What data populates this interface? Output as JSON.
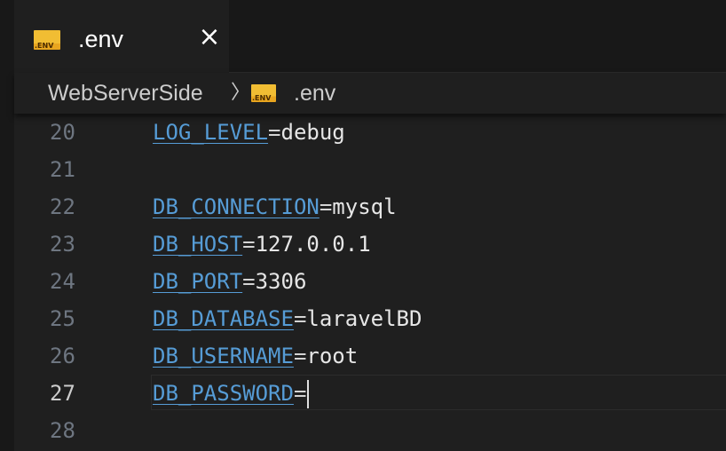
{
  "tab": {
    "icon_text": ".ENV",
    "label": ".env",
    "close_glyph": "×"
  },
  "breadcrumb": {
    "folder": "WebServerSide",
    "separator": "〉",
    "icon_text": ".ENV",
    "file": ".env"
  },
  "editor": {
    "active_line": 27,
    "lines": [
      {
        "num": "20",
        "key": "LOG_LEVEL",
        "eq": "=",
        "value": "debug"
      },
      {
        "num": "21",
        "key": "",
        "eq": "",
        "value": ""
      },
      {
        "num": "22",
        "key": "DB_CONNECTION",
        "eq": "=",
        "value": "mysql"
      },
      {
        "num": "23",
        "key": "DB_HOST",
        "eq": "=",
        "value": "127.0.0.1"
      },
      {
        "num": "24",
        "key": "DB_PORT",
        "eq": "=",
        "value": "3306"
      },
      {
        "num": "25",
        "key": "DB_DATABASE",
        "eq": "=",
        "value": "laravelBD"
      },
      {
        "num": "26",
        "key": "DB_USERNAME",
        "eq": "=",
        "value": "root"
      },
      {
        "num": "27",
        "key": "DB_PASSWORD",
        "eq": "=",
        "value": ""
      },
      {
        "num": "28",
        "key": "",
        "eq": "",
        "value": ""
      }
    ]
  },
  "colors": {
    "editor_bg": "#1f1f1f",
    "tabbar_bg": "#181818",
    "env_key": "#569cd6",
    "env_icon": "#f1bd33",
    "line_number": "#6e7681",
    "active_line_number": "#cccccc"
  }
}
